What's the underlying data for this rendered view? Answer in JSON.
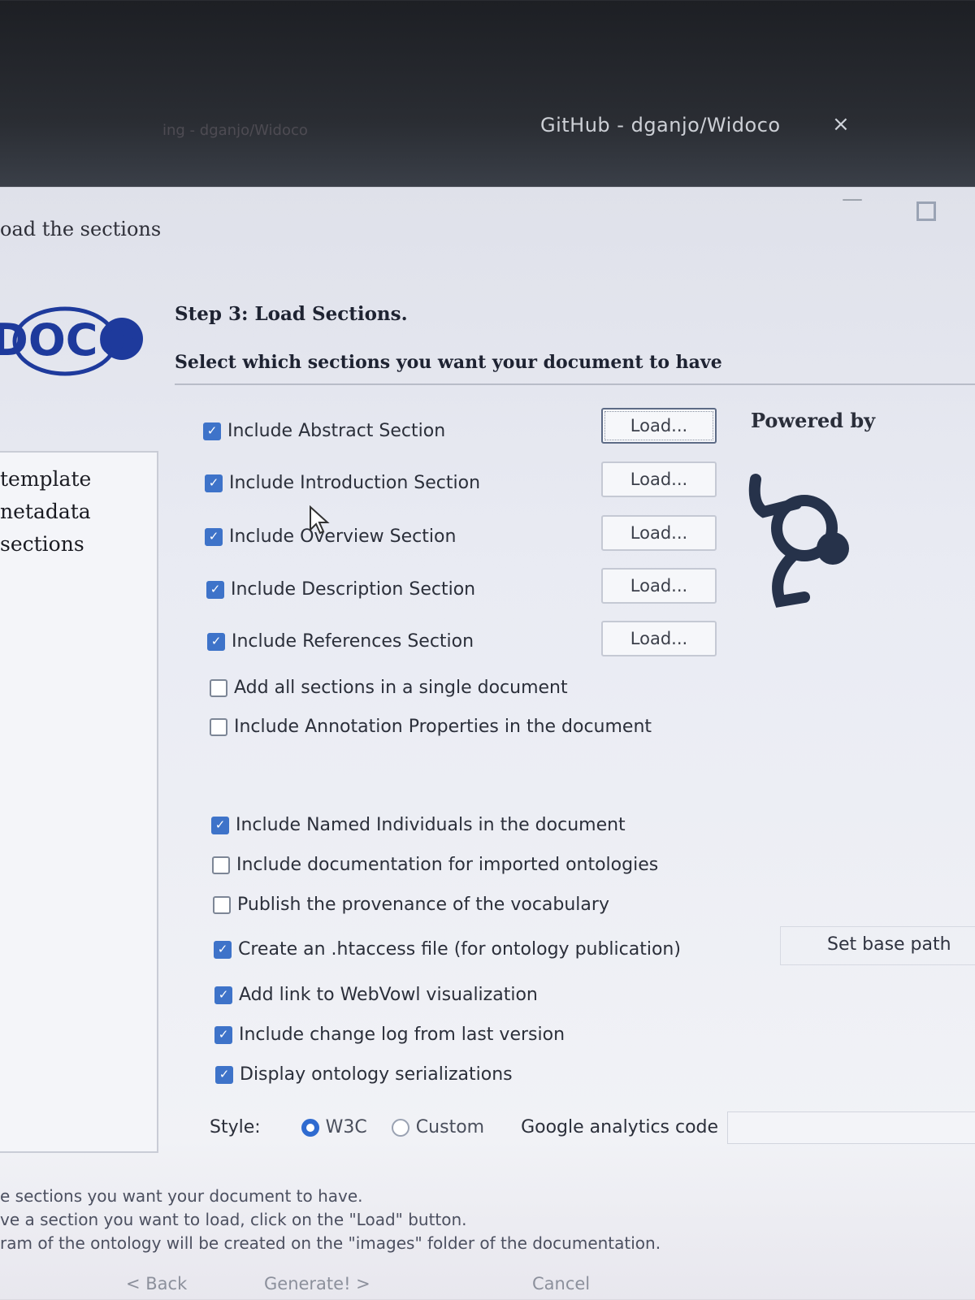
{
  "browser": {
    "tab_title": "GitHub - dganjo/Widoco",
    "tab_close": "×",
    "blurred_tab": "ing - dganjo/Widoco"
  },
  "window": {
    "minimize": "—",
    "header_text": "oad the sections"
  },
  "logo": {
    "text": "DOCO"
  },
  "sidebar": {
    "items": [
      {
        "label": "template"
      },
      {
        "label": "netadata"
      },
      {
        "label": "sections"
      }
    ]
  },
  "main": {
    "step_title": "Step 3: Load Sections.",
    "step_subtitle": "Select which sections you want your document to have",
    "sections": [
      {
        "label": "Include Abstract Section",
        "checked": true,
        "load": "Load..."
      },
      {
        "label": "Include Introduction Section",
        "checked": true,
        "load": "Load..."
      },
      {
        "label": "Include Overview Section",
        "checked": true,
        "load": "Load..."
      },
      {
        "label": "Include Description Section",
        "checked": true,
        "load": "Load..."
      },
      {
        "label": "Include References Section",
        "checked": true,
        "load": "Load..."
      }
    ],
    "options_a": [
      {
        "label": "Add all sections in a single document",
        "checked": false
      },
      {
        "label": "Include Annotation Properties in the document",
        "checked": false
      }
    ],
    "options_b": [
      {
        "label": "Include Named Individuals in the document",
        "checked": true
      },
      {
        "label": "Include documentation for imported ontologies",
        "checked": false
      },
      {
        "label": "Publish the provenance of the vocabulary",
        "checked": false
      },
      {
        "label": "Create an .htaccess file (for ontology publication)",
        "checked": true
      },
      {
        "label": "Add link to WebVowl visualization",
        "checked": true
      },
      {
        "label": "Include change log from last version",
        "checked": true
      },
      {
        "label": "Display ontology serializations",
        "checked": true
      }
    ],
    "set_base_path": "Set base path",
    "style_label": "Style:",
    "style_options": [
      {
        "label": "W3C",
        "selected": true
      },
      {
        "label": "Custom",
        "selected": false
      }
    ],
    "google_analytics_label": "Google analytics code",
    "google_analytics_value": ""
  },
  "powered_by": "Powered by",
  "status_lines": [
    "e sections you want your document to have.",
    "ve a section you want to load, click on the \"Load\" button.",
    "ram of the ontology will be created on the \"images\" folder of the documentation."
  ],
  "buttons": {
    "back": "< Back",
    "generate": "Generate! >",
    "cancel": "Cancel"
  },
  "colors": {
    "checkbox_on": "#3e73c9",
    "logo_blue": "#1e3a9c",
    "radio_on": "#2f6bd0"
  }
}
